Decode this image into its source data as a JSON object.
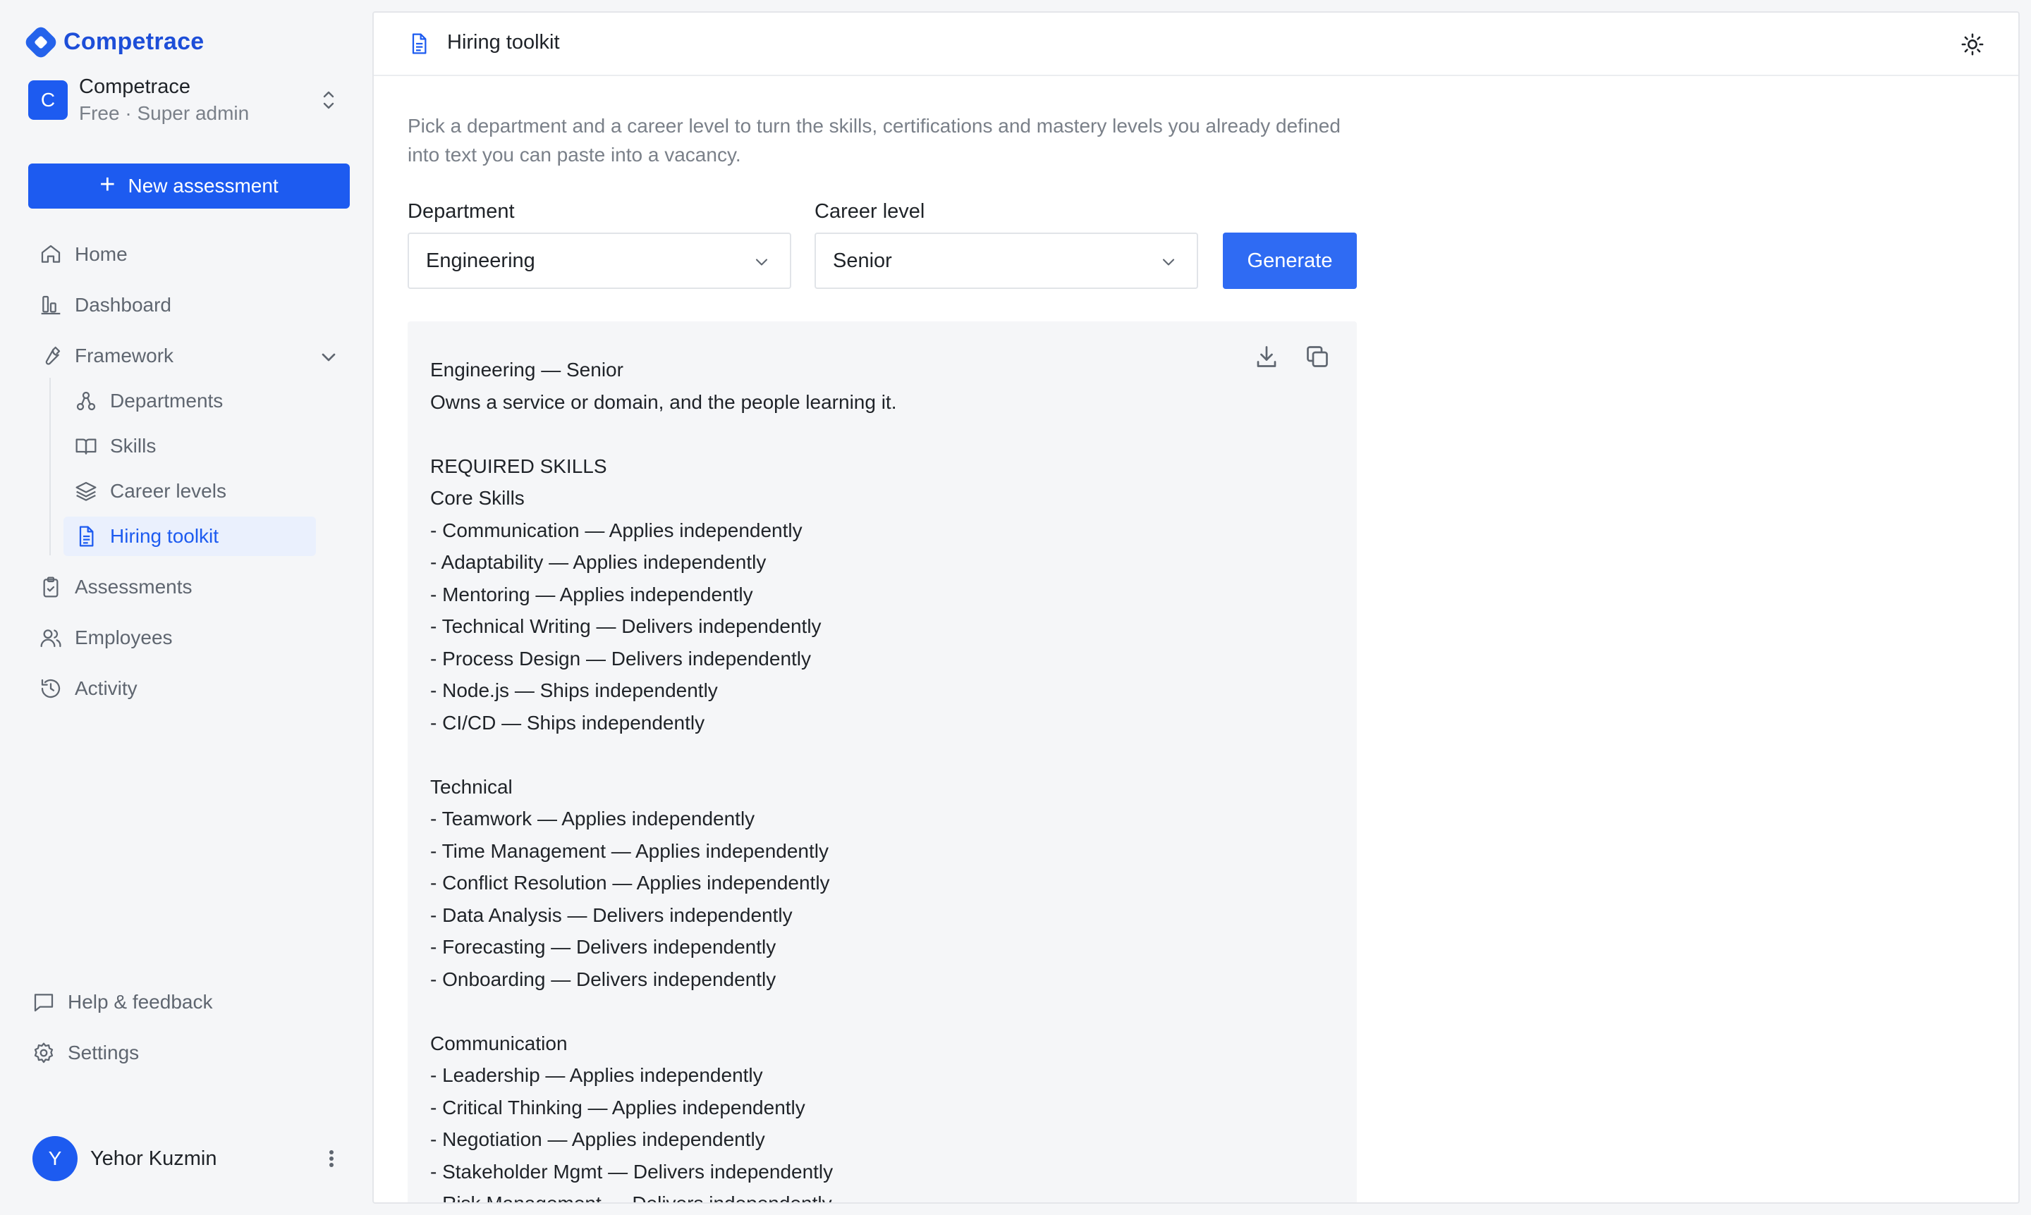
{
  "brand": {
    "name": "Competrace"
  },
  "org": {
    "avatar_letter": "C",
    "name": "Competrace",
    "plan": "Free · Super admin"
  },
  "sidebar": {
    "new_button": "New assessment",
    "items": [
      {
        "label": "Home",
        "icon": "home-icon"
      },
      {
        "label": "Dashboard",
        "icon": "bar-chart-icon"
      },
      {
        "label": "Framework",
        "icon": "wrench-icon",
        "expanded": true
      },
      {
        "label": "Departments",
        "icon": "hierarchy-icon"
      },
      {
        "label": "Skills",
        "icon": "book-icon"
      },
      {
        "label": "Career levels",
        "icon": "layers-icon"
      },
      {
        "label": "Hiring toolkit",
        "icon": "document-icon",
        "active": true
      },
      {
        "label": "Assessments",
        "icon": "clipboard-icon"
      },
      {
        "label": "Employees",
        "icon": "users-icon"
      },
      {
        "label": "Activity",
        "icon": "history-icon"
      }
    ],
    "footer": [
      {
        "label": "Help & feedback",
        "icon": "message-icon"
      },
      {
        "label": "Settings",
        "icon": "gear-icon"
      }
    ]
  },
  "user": {
    "avatar_letter": "Y",
    "name": "Yehor Kuzmin"
  },
  "header": {
    "title": "Hiring toolkit"
  },
  "intro": "Pick a department and a career level to turn the skills, certifications and mastery levels you already defined into text you can paste into a vacancy.",
  "form": {
    "department_label": "Department",
    "department_value": "Engineering",
    "level_label": "Career level",
    "level_value": "Senior",
    "generate_label": "Generate"
  },
  "output": {
    "lines": [
      "Engineering — Senior",
      "Owns a service or domain, and the people learning it.",
      "",
      "REQUIRED SKILLS",
      "Core Skills",
      "- Communication — Applies independently",
      "- Adaptability — Applies independently",
      "- Mentoring — Applies independently",
      "- Technical Writing — Delivers independently",
      "- Process Design — Delivers independently",
      "- Node.js — Ships independently",
      "- CI/CD — Ships independently",
      "",
      "Technical",
      "- Teamwork — Applies independently",
      "- Time Management — Applies independently",
      "- Conflict Resolution — Applies independently",
      "- Data Analysis — Delivers independently",
      "- Forecasting — Delivers independently",
      "- Onboarding — Delivers independently",
      "",
      "Communication",
      "- Leadership — Applies independently",
      "- Critical Thinking — Applies independently",
      "- Negotiation — Applies independently",
      "- Stakeholder Mgmt — Delivers independently",
      "- Risk Management — Delivers independently"
    ]
  },
  "colors": {
    "accent": "#1d5bf0",
    "button": "#2f6bf3",
    "muted": "#7a8089",
    "panel": "#f5f6f8"
  }
}
